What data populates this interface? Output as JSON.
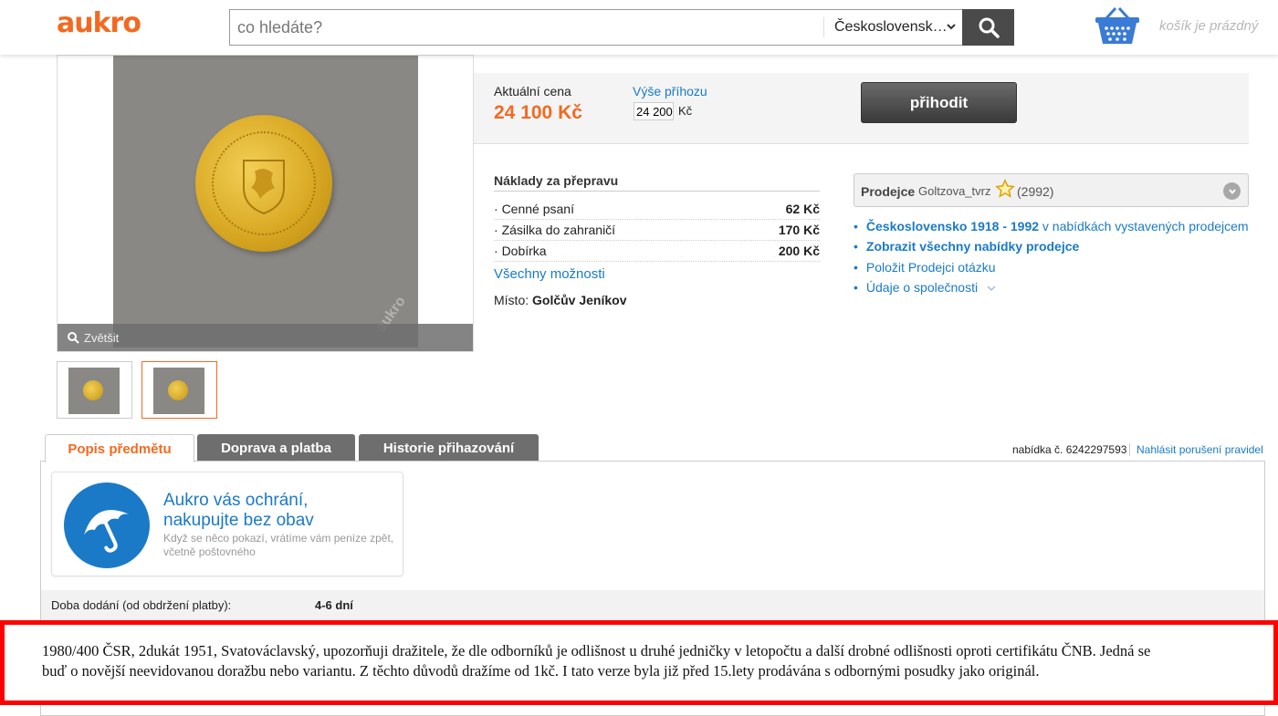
{
  "header": {
    "logo": "aukro",
    "search_placeholder": "co hledáte?",
    "category": "Československ…",
    "basket_label": "košík je prázdný"
  },
  "gallery": {
    "zoom_label": "Zvětšit",
    "watermark": "aukro"
  },
  "price": {
    "label": "Aktuální cena",
    "value": "24 100 Kč",
    "bid_label": "Výše příhozu",
    "bid_value": "24 200",
    "bid_currency": "Kč",
    "bid_button": "přihodit"
  },
  "shipping": {
    "title": "Náklady za přepravu",
    "rows": [
      {
        "name": "Cenné psaní",
        "price": "62 Kč"
      },
      {
        "name": "Zásilka do zahraničí",
        "price": "170 Kč"
      },
      {
        "name": "Dobírka",
        "price": "200 Kč"
      }
    ],
    "all_options": "Všechny možnosti",
    "place_label": "Místo:",
    "place_value": "Golčův Jeníkov"
  },
  "seller": {
    "label": "Prodejce",
    "name": "Goltzova_tvrz",
    "rating_count": "(2992)",
    "links": {
      "category_bold": "Československo 1918 - 1992",
      "category_rest": " v nabídkách vystavených prodejcem",
      "all_offers": "Zobrazit všechny nabídky prodejce",
      "ask": "Položit Prodejci otázku",
      "company": "Údaje o společnosti"
    }
  },
  "tabs": {
    "description": "Popis předmětu",
    "shipping": "Doprava a platba",
    "history": "Historie přihazování"
  },
  "offer": {
    "number": "nabídka č. 6242297593",
    "report": "Nahlásit porušení pravidel"
  },
  "protection": {
    "headline_1": "Aukro vás ochrání,",
    "headline_2": "nakupujte bez obav",
    "sub_1": "Když se něco pokazí, vrátíme vám peníze zpět,",
    "sub_2": "včetně poštovného"
  },
  "delivery": {
    "label": "Doba dodání (od obdržení platby):",
    "value": "4-6 dní"
  },
  "description": {
    "line_1": "1980/400 ČSR, 2dukát 1951, Svatováclavský, upozorňuji dražitele, že dle odborníků je odlišnost u druhé jedničky v letopočtu a další drobné odlišnosti oproti certifikátu ČNB. Jedná se",
    "line_2": "buď o novější neevidovanou doražbu nebo variantu. Z těchto důvodů dražíme od 1kč. I tato verze byla již před 15.lety prodávána s odbornými posudky jako originál."
  },
  "colors": {
    "brand_orange": "#f26a21",
    "link_blue": "#1a7ac8",
    "highlight_red": "#ff0000"
  }
}
